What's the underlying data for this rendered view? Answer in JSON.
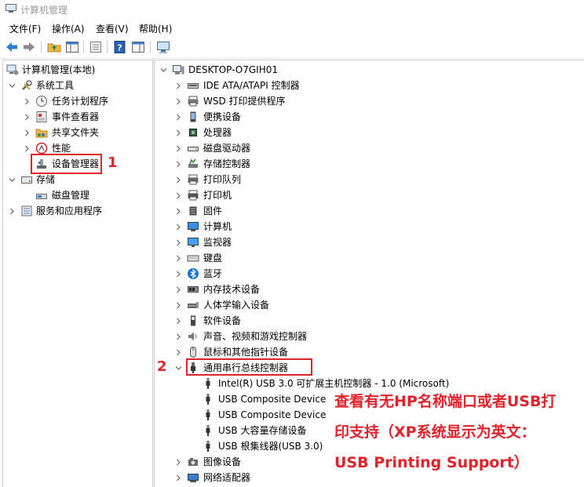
{
  "window": {
    "title": "计算机管理"
  },
  "menu": [
    "文件(F)",
    "操作(A)",
    "查看(V)",
    "帮助(H)"
  ],
  "toolbar": [
    "back-arrow-icon",
    "forward-arrow-icon",
    "up-folder-icon",
    "show-tree-icon",
    "properties-icon",
    "help-icon",
    "action-pane-icon",
    "monitor-icon"
  ],
  "left_tree": {
    "root": "计算机管理(本地)",
    "system_tools": "系统工具",
    "task_scheduler": "任务计划程序",
    "event_viewer": "事件查看器",
    "shared_folders": "共享文件夹",
    "performance": "性能",
    "device_manager": "设备管理器",
    "storage": "存储",
    "disk_management": "磁盘管理",
    "services": "服务和应用程序"
  },
  "device_tree": {
    "root": "DESKTOP-O7GIH01",
    "categories": [
      "IDE ATA/ATAPI 控制器",
      "WSD 打印提供程序",
      "便携设备",
      "处理器",
      "磁盘驱动器",
      "存储控制器",
      "打印队列",
      "打印机",
      "固件",
      "计算机",
      "监视器",
      "键盘",
      "蓝牙",
      "内存技术设备",
      "人体学输入设备",
      "软件设备",
      "声音、视频和游戏控制器",
      "鼠标和其他指针设备"
    ],
    "usb_category": "通用串行总线控制器",
    "usb_children": [
      "Intel(R) USB 3.0 可扩展主机控制器 - 1.0 (Microsoft)",
      "USB Composite Device",
      "USB Composite Device",
      "USB 大容量存储设备",
      "USB 根集线器(USB 3.0)"
    ],
    "after_categories": [
      "图像设备",
      "网络适配器"
    ]
  },
  "annotations": {
    "step1": "1",
    "step2": "2",
    "note_line1": "查看有无HP名称端口或者USB打",
    "note_line2": "印支持（XP系统显示为英文：",
    "note_line3": "USB Printing Support）"
  },
  "colors": {
    "highlight_red": "#e3212b",
    "title_gray": "#999999"
  }
}
